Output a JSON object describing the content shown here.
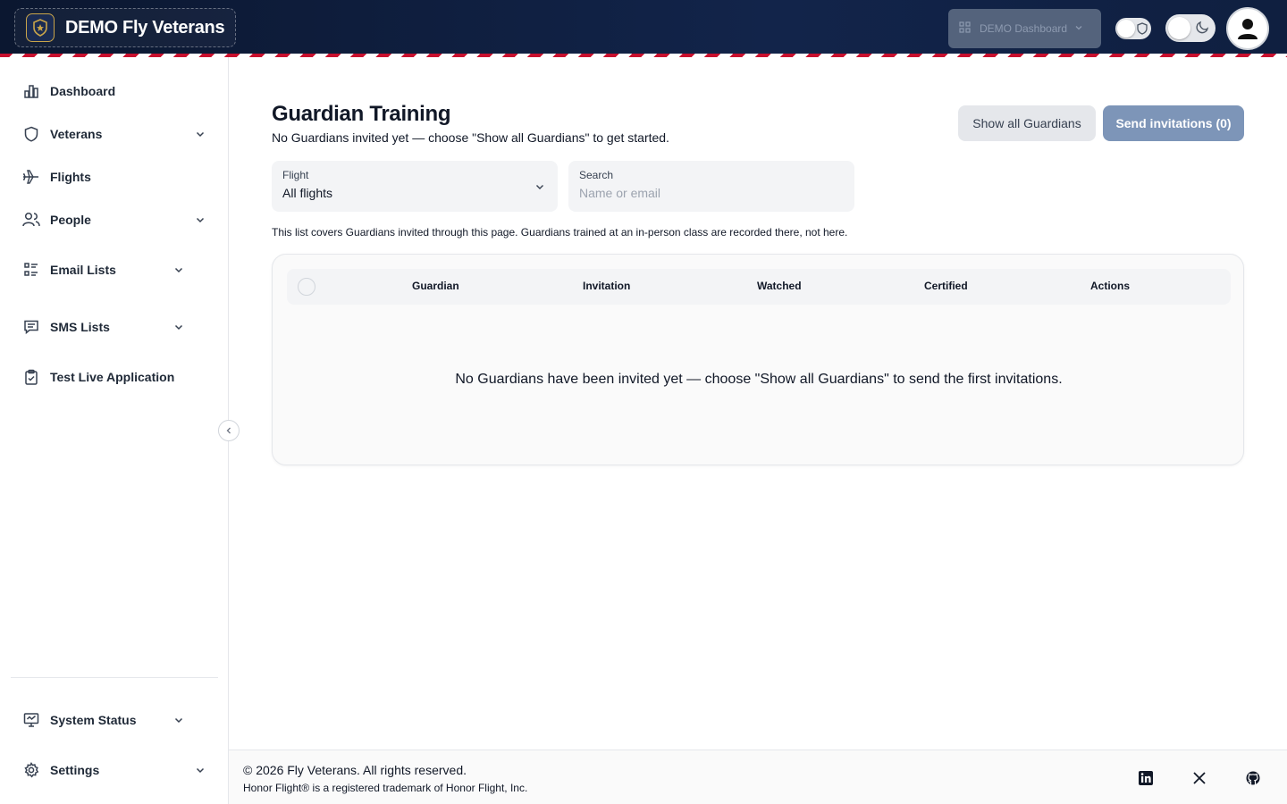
{
  "header": {
    "brand_title": "DEMO Fly Veterans",
    "brand_icon": "shield-star-icon",
    "demo_dropdown_label": "DEMO Dashboard"
  },
  "sidebar": {
    "items": [
      {
        "label": "Dashboard",
        "icon": "bar-chart-icon",
        "has_chevron": false
      },
      {
        "label": "Veterans",
        "icon": "shield-icon",
        "has_chevron": true
      },
      {
        "label": "Flights",
        "icon": "plane-icon",
        "has_chevron": false
      },
      {
        "label": "People",
        "icon": "people-icon",
        "has_chevron": true
      },
      {
        "label": "Email Lists",
        "icon": "list-icon",
        "has_chevron": true
      },
      {
        "label": "SMS Lists",
        "icon": "message-icon",
        "has_chevron": true
      },
      {
        "label": "Test Live Application",
        "icon": "clipboard-check-icon",
        "has_chevron": false
      }
    ],
    "bottom_items": [
      {
        "label": "System Status",
        "icon": "monitor-icon",
        "has_chevron": true
      },
      {
        "label": "Settings",
        "icon": "gear-icon",
        "has_chevron": true
      }
    ]
  },
  "main": {
    "title": "Guardian Training",
    "subtitle": "No Guardians invited yet — choose \"Show all Guardians\" to get started.",
    "show_all_button": "Show all Guardians",
    "send_button": "Send invitations (0)",
    "flight_filter": {
      "label": "Flight",
      "value": "All flights"
    },
    "search": {
      "label": "Search",
      "placeholder": "Name or email"
    },
    "note": "This list covers Guardians invited through this page. Guardians trained at an in-person class are recorded there, not here.",
    "table": {
      "columns": [
        "Guardian",
        "Invitation",
        "Watched",
        "Certified",
        "Actions"
      ],
      "empty_message": "No Guardians have been invited yet — choose \"Show all Guardians\" to send the first invitations."
    }
  },
  "footer": {
    "copyright": "© 2026 Fly Veterans. All rights reserved.",
    "trademark": "Honor Flight® is a registered trademark of Honor Flight, Inc.",
    "social_icons": [
      "linkedin-icon",
      "x-icon",
      "github-icon"
    ]
  },
  "colors": {
    "header_bg": "#0b1730",
    "stripe_red": "#c8102e",
    "send_button_bg": "#7d95b8",
    "demo_dropdown_bg": "#54637c"
  }
}
